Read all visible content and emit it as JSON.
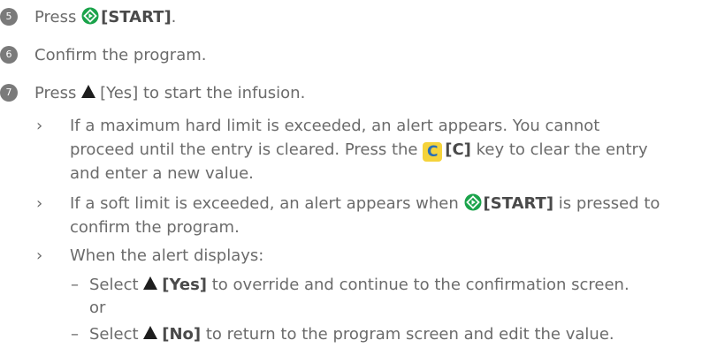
{
  "steps": [
    {
      "number": "5",
      "pre": "Press ",
      "key": "[START]",
      "post": "."
    },
    {
      "number": "6",
      "text": "Confirm the program."
    },
    {
      "number": "7",
      "pre": "Press ",
      "key": "[Yes]",
      "post": " to start the infusion."
    }
  ],
  "bullets": [
    {
      "line1": "If a maximum hard limit is exceeded, an alert appears. You cannot",
      "line2_pre": "proceed until the entry is cleared. Press the ",
      "c_glyph": "C",
      "c_key": "[C]",
      "line2_post": " key to clear the entry",
      "line3": "and enter a new value."
    },
    {
      "line1_pre": "If a soft limit is exceeded, an alert appears when ",
      "key": "[START]",
      "line1_post": " is pressed to",
      "line2": "confirm the program."
    },
    {
      "text": "When the alert displays:"
    }
  ],
  "sub_items": [
    {
      "pre": "Select ",
      "key": "[Yes]",
      "post": " to override and continue to the confirmation screen.",
      "continuation": "or"
    },
    {
      "pre": "Select ",
      "key": "[No]",
      "post": " to return to the program screen and edit the value."
    }
  ],
  "symbols": {
    "chevron": "›",
    "dash": "–"
  },
  "icons": {
    "start": "start-diamond-icon",
    "up": "up-triangle-icon",
    "clear": "clear-key-icon"
  },
  "colors": {
    "text": "#6b6b6b",
    "bold_text": "#4a4a4a",
    "start_icon": "#1aa34a",
    "clear_key_bg": "#f5d33b",
    "clear_key_fg": "#2a6fb5"
  }
}
